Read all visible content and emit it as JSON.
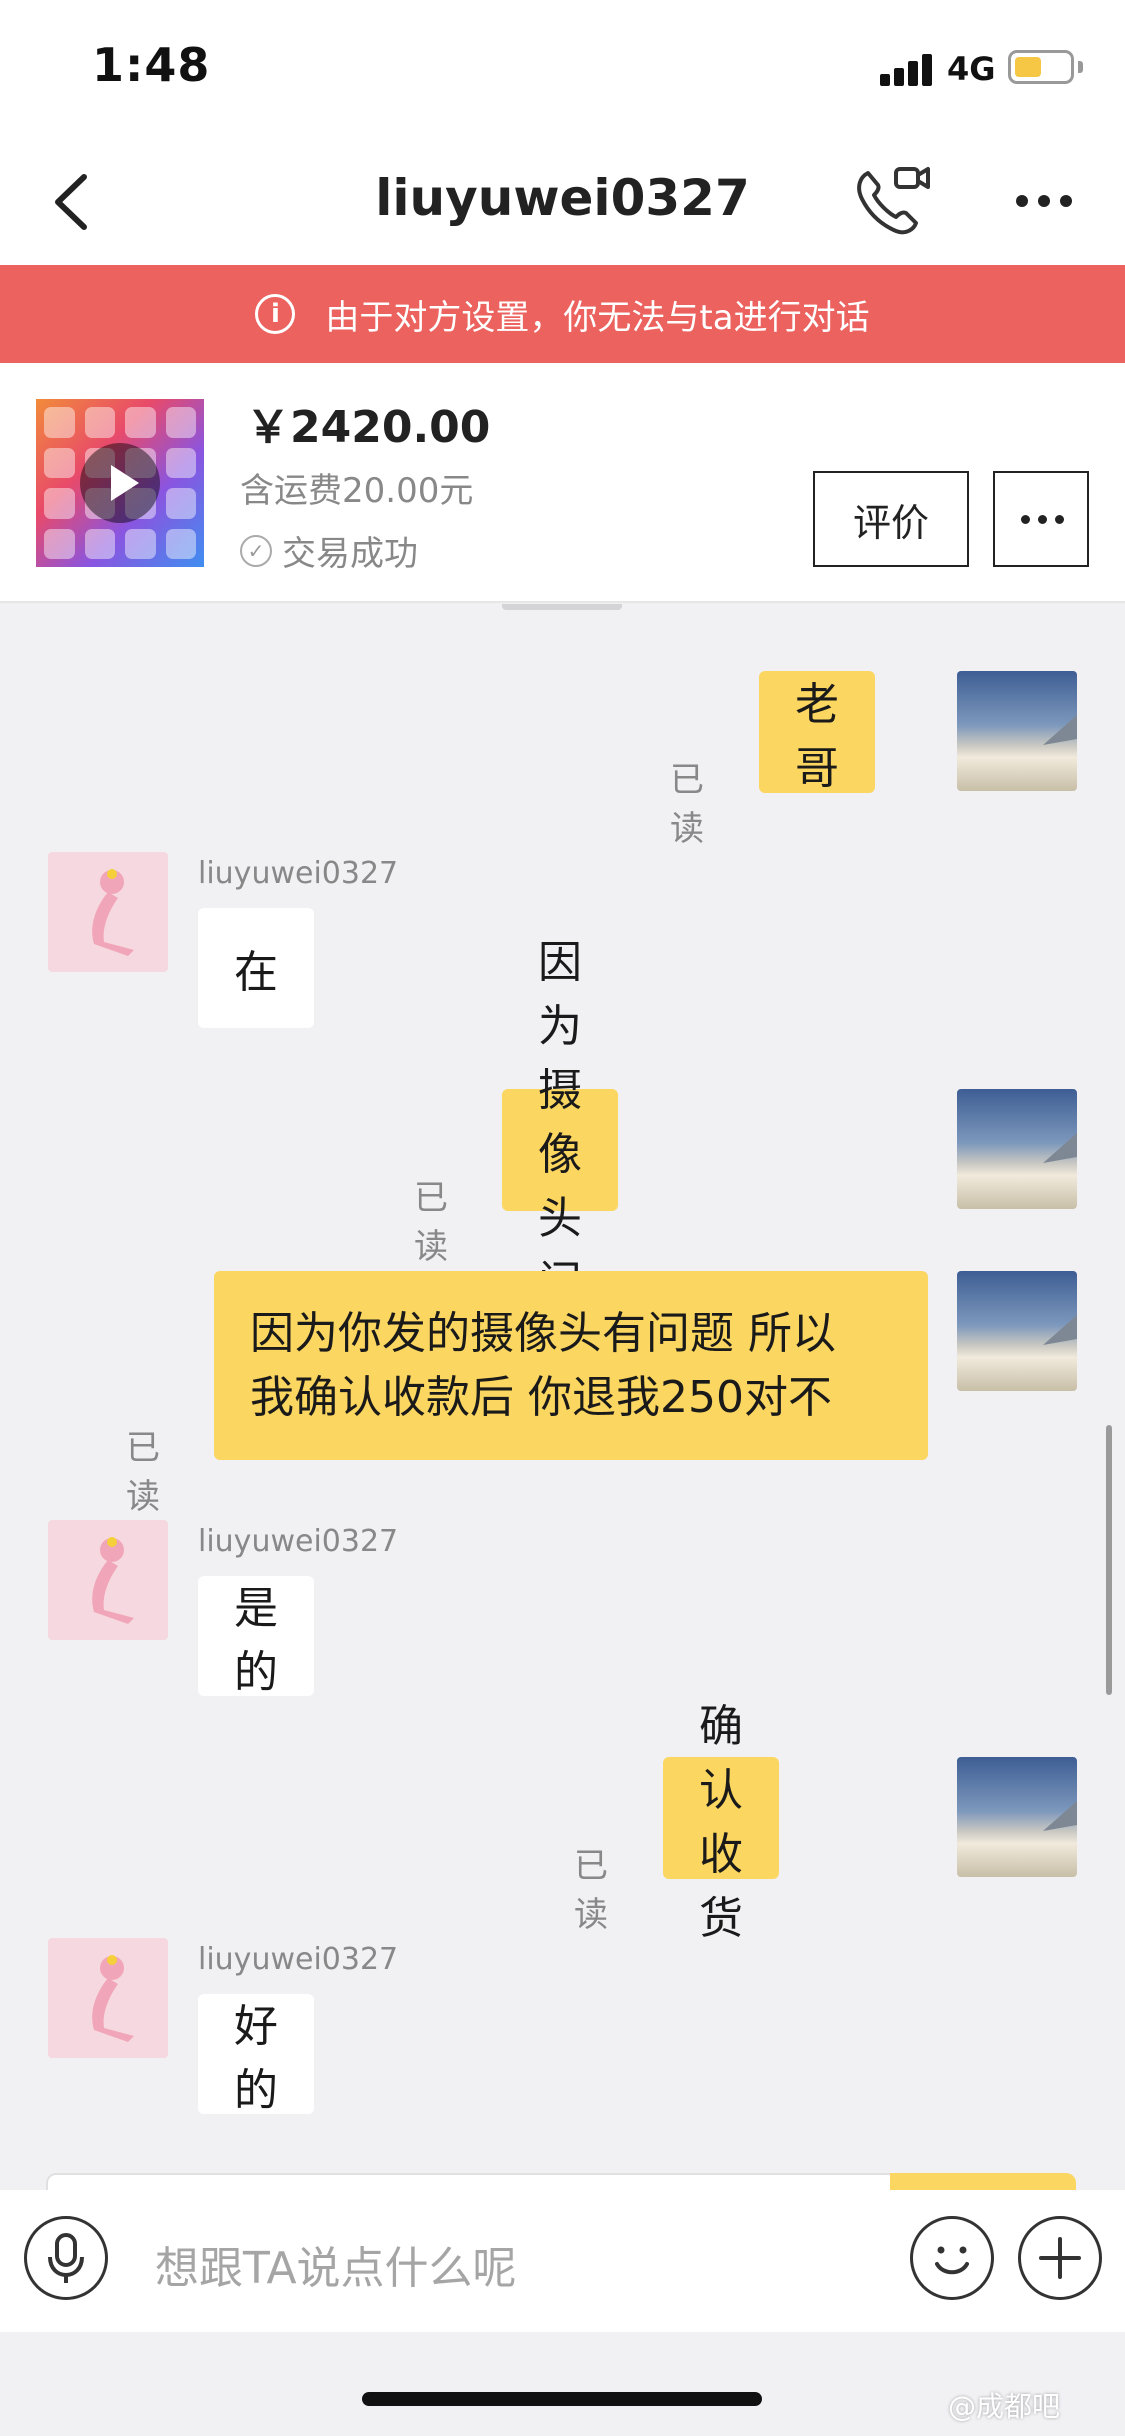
{
  "status_bar": {
    "time": "1:48",
    "network": "4G"
  },
  "nav": {
    "title": "liuyuwei0327"
  },
  "banner": {
    "text": "由于对方设置，你无法与ta进行对话"
  },
  "product": {
    "price": "￥2420.00",
    "shipping": "含运费20.00元",
    "status": "交易成功",
    "review_label": "评价"
  },
  "messages": [
    {
      "from": "me",
      "text": "老哥",
      "read": "已读"
    },
    {
      "from": "them",
      "sender": "liuyuwei0327",
      "text": "在"
    },
    {
      "from": "me",
      "text": "因为摄像头问题",
      "read": "已读"
    },
    {
      "from": "me",
      "line1": "因为你发的摄像头有问题 所以",
      "line2": "我确认收款后 你退我250对不",
      "read": "已读"
    },
    {
      "from": "them",
      "sender": "liuyuwei0327",
      "text": "是的"
    },
    {
      "from": "me",
      "text": "确认收货",
      "read": "已读"
    },
    {
      "from": "them",
      "sender": "liuyuwei0327",
      "text": "好的"
    }
  ],
  "input": {
    "placeholder": "想跟TA说点什么呢"
  },
  "watermark": "@成都吧",
  "colors": {
    "banner": "#eb625e",
    "my_bubble": "#fbd660",
    "their_bubble": "#ffffff",
    "background": "#f1f1f4"
  }
}
